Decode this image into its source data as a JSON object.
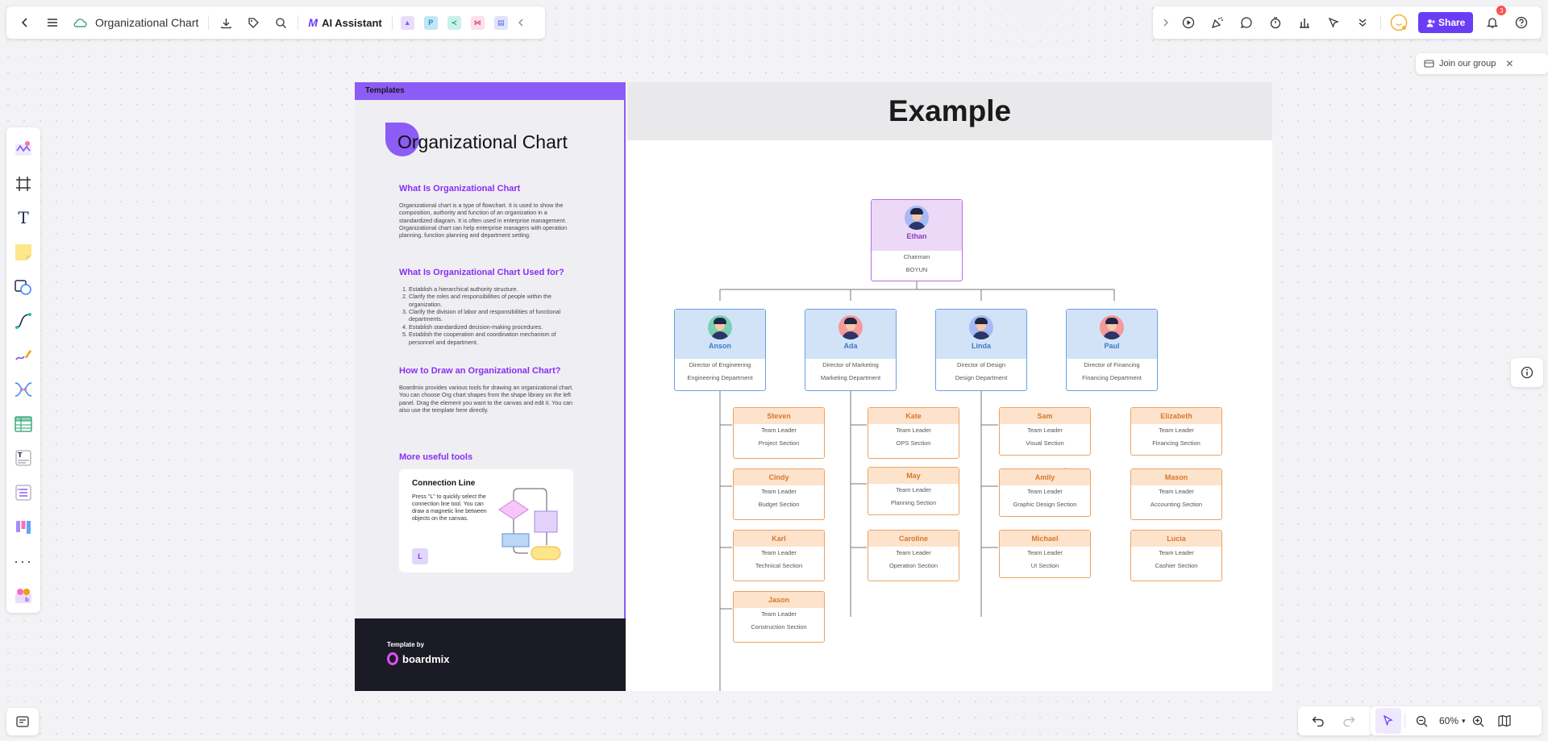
{
  "toolbar": {
    "title": "Organizational Chart",
    "ai_label": "AI Assistant",
    "share_label": "Share",
    "notification_count": "3"
  },
  "join": {
    "label": "Join our group"
  },
  "zoom": {
    "value": "60%"
  },
  "template": {
    "bar_label": "Templates",
    "title": "Organizational Chart",
    "section1_title": "What Is Organizational Chart",
    "section1_text": "Organizational chart is a type of flowchart. It is used to show the composition, authority and function of an organization in a standardized diagram. It is often used in enterprise management. Organizational chart can help enterprise managers with operation planning, function planning and department setting.",
    "section2_title": "What Is Organizational Chart Used for?",
    "section2_items": [
      "Establish a hierarchical authority structure.",
      "Clarify the roles and responsibilities of people within the organization.",
      "Clarify the division of labor and responsibilities of functional departments.",
      "Establish standardized decision-making procedures.",
      "Establish the cooperation and coordination mechanism of personnel and department."
    ],
    "section3_title": "How to Draw an Organizational Chart?",
    "section3_text": "Boardmix provides various tools for drawing an organizational chart. You can choose Org chart shapes from the shape library on the left panel. Drag the element you want to the canvas and edit it. You can also use the template here directly.",
    "tools_title": "More useful tools",
    "tool_card_title": "Connection Line",
    "tool_card_text": "Press \"L\" to quickly select the connection line tool. You can draw a magnetic line between objects on the canvas.",
    "tool_key": "L",
    "template_by": "Template by",
    "brand": "boardmix"
  },
  "example_title": "Example",
  "org": {
    "chairman": {
      "name": "Ethan",
      "title": "Chairman",
      "dept": "BOYUN"
    },
    "directors": [
      {
        "name": "Anson",
        "title": "Director of Engineering",
        "dept": "Engineering Department"
      },
      {
        "name": "Ada",
        "title": "Director of Marketing",
        "dept": "Marketing Department"
      },
      {
        "name": "Linda",
        "title": "Director of Design",
        "dept": "Design Department"
      },
      {
        "name": "Paul",
        "title": "Director of Financing",
        "dept": "Financing Department"
      }
    ],
    "leaders": [
      [
        {
          "name": "Steven",
          "title": "Team Leader",
          "dept": "Project Section"
        },
        {
          "name": "Cindy",
          "title": "Team Leader",
          "dept": "Budget Section"
        },
        {
          "name": "Karl",
          "title": "Team Leader",
          "dept": "Technical Section"
        },
        {
          "name": "Jason",
          "title": "Team Leader",
          "dept": "Construction Section"
        }
      ],
      [
        {
          "name": "Kate",
          "title": "Team Leader",
          "dept": "OPS Section"
        },
        {
          "name": "May",
          "title": "Team Leader",
          "dept": "Planning Section"
        },
        {
          "name": "Caroline",
          "title": "Team Leader",
          "dept": "Operation Section"
        }
      ],
      [
        {
          "name": "Sam",
          "title": "Team Leader",
          "dept": "Visual Section"
        },
        {
          "name": "Amily",
          "title": "Team Leader",
          "dept": "Graphic Design Section"
        },
        {
          "name": "Michael",
          "title": "Team Leader",
          "dept": "UI Section"
        }
      ],
      [
        {
          "name": "Elizabeth",
          "title": "Team Leader",
          "dept": "Financing Section"
        },
        {
          "name": "Mason",
          "title": "Team Leader",
          "dept": "Accounting Section"
        },
        {
          "name": "Lucia",
          "title": "Team Leader",
          "dept": "Cashier Section"
        }
      ]
    ]
  },
  "colors": {
    "accent": "#6a3df5",
    "template_purple": "#8b5cf6",
    "chairman_border": "#b66ee0",
    "director_border": "#6aa0e6",
    "leader_border": "#eaa364"
  }
}
